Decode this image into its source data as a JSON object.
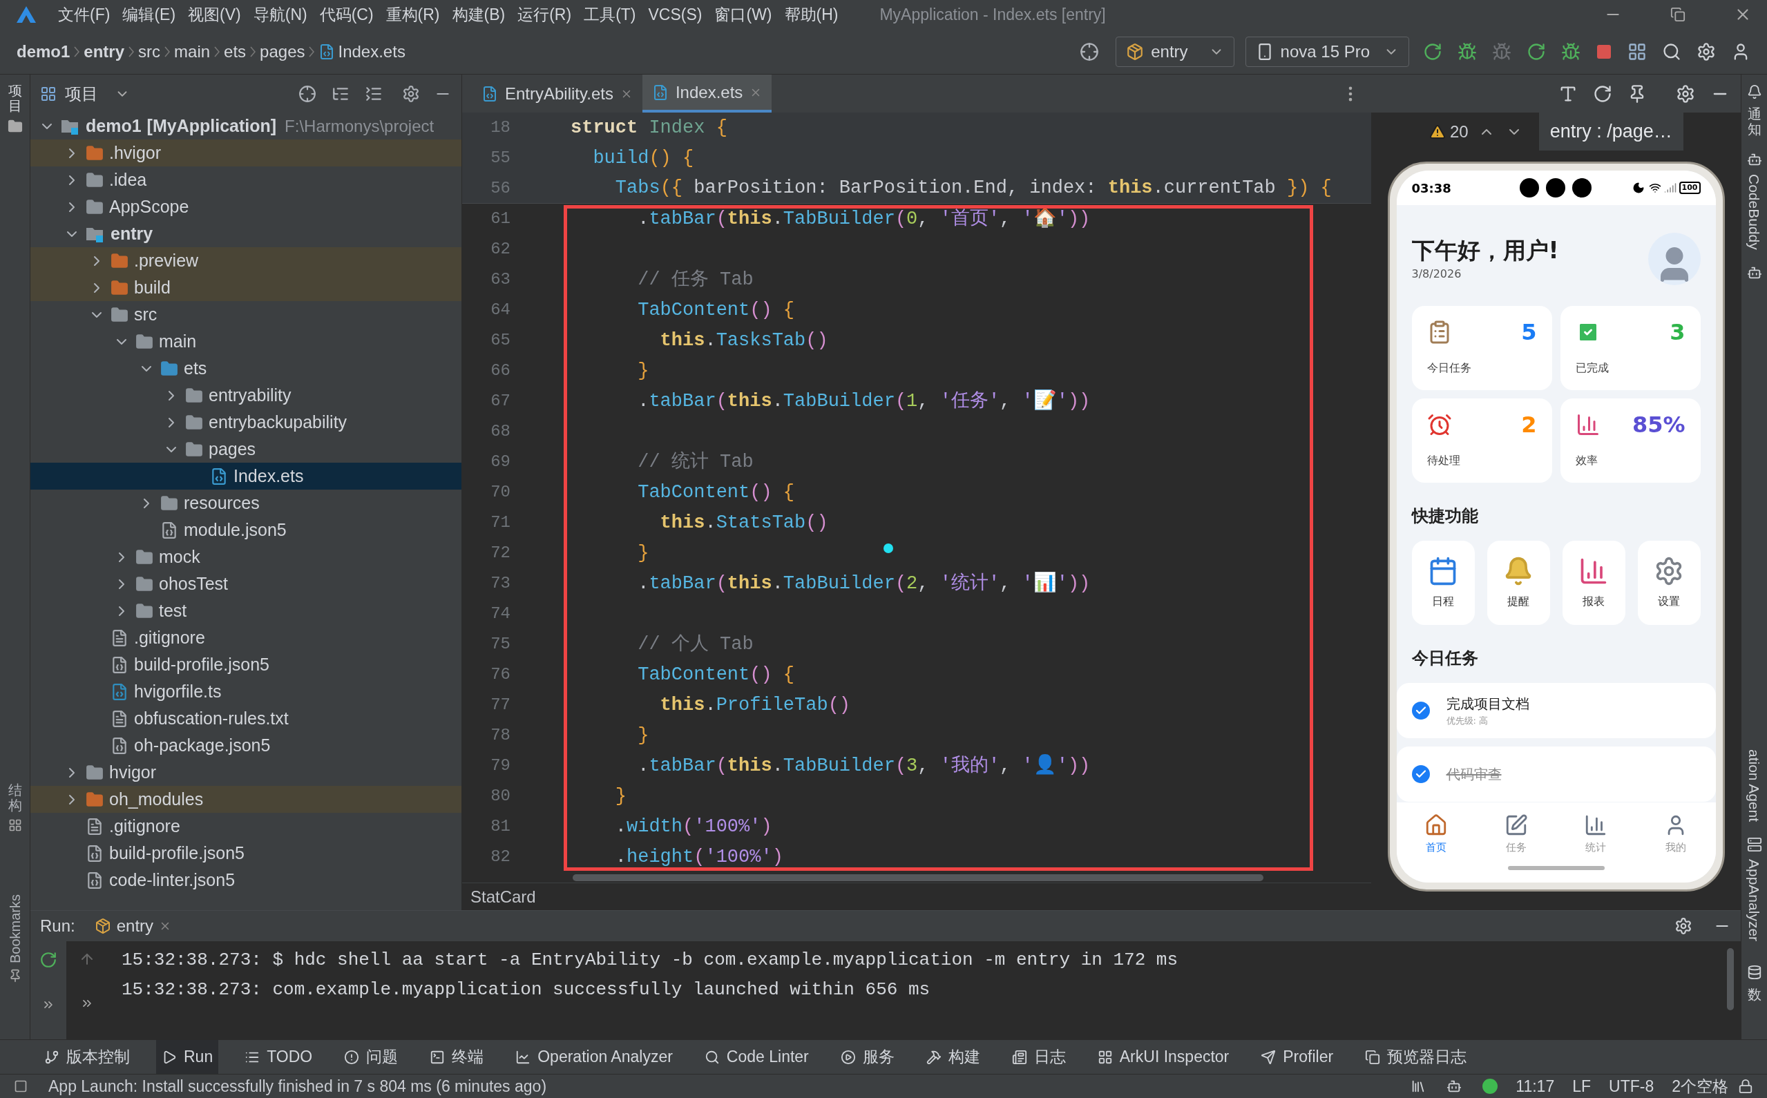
{
  "window": {
    "title": "MyApplication - Index.ets [entry]",
    "menu": [
      "文件(F)",
      "编辑(E)",
      "视图(V)",
      "导航(N)",
      "代码(C)",
      "重构(R)",
      "构建(B)",
      "运行(R)",
      "工具(T)",
      "VCS(S)",
      "窗口(W)",
      "帮助(H)"
    ]
  },
  "breadcrumb": [
    {
      "label": "demo1",
      "bold": true
    },
    {
      "label": "entry",
      "bold": true
    },
    {
      "label": "src",
      "bold": false
    },
    {
      "label": "main",
      "bold": false
    },
    {
      "label": "ets",
      "bold": false
    },
    {
      "label": "pages",
      "bold": false
    },
    {
      "label": "Index.ets",
      "bold": false
    }
  ],
  "toolbar": {
    "run_config": "entry",
    "device": "nova 15 Pro"
  },
  "left_strip": {
    "top": "项目",
    "bottom": "结构",
    "bookmarks": "Bookmarks"
  },
  "project": {
    "title": "项目",
    "tree": [
      {
        "label": "demo1",
        "tag": "[MyApplication]",
        "path": "F:\\Harmonys\\project",
        "kind": "module",
        "expanded": true,
        "selected": false,
        "children": [
          {
            "label": ".hvigor",
            "kind": "excluded-folder",
            "expanded": false,
            "selected": false
          },
          {
            "label": ".idea",
            "kind": "folder",
            "expanded": false,
            "selected": false
          },
          {
            "label": "AppScope",
            "kind": "folder",
            "expanded": false,
            "selected": false
          },
          {
            "label": "entry",
            "kind": "module",
            "expanded": true,
            "selected": false,
            "children": [
              {
                "label": ".preview",
                "kind": "excluded-folder",
                "expanded": false,
                "selected": false
              },
              {
                "label": "build",
                "kind": "excluded-folder",
                "expanded": false,
                "selected": false
              },
              {
                "label": "src",
                "kind": "folder",
                "expanded": true,
                "selected": false,
                "children": [
                  {
                    "label": "main",
                    "kind": "folder",
                    "expanded": true,
                    "selected": false,
                    "children": [
                      {
                        "label": "ets",
                        "kind": "source-folder",
                        "expanded": true,
                        "selected": false,
                        "children": [
                          {
                            "label": "entryability",
                            "kind": "folder",
                            "expanded": false,
                            "selected": false
                          },
                          {
                            "label": "entrybackupability",
                            "kind": "folder",
                            "expanded": false,
                            "selected": false
                          },
                          {
                            "label": "pages",
                            "kind": "folder",
                            "expanded": true,
                            "selected": false,
                            "children": [
                              {
                                "label": "Index.ets",
                                "kind": "ets-file",
                                "selected": true
                              }
                            ]
                          }
                        ]
                      },
                      {
                        "label": "resources",
                        "kind": "folder",
                        "expanded": false,
                        "selected": false
                      },
                      {
                        "label": "module.json5",
                        "kind": "json-file",
                        "selected": false
                      }
                    ]
                  },
                  {
                    "label": "mock",
                    "kind": "folder",
                    "expanded": false,
                    "selected": false
                  },
                  {
                    "label": "ohosTest",
                    "kind": "folder",
                    "expanded": false,
                    "selected": false
                  },
                  {
                    "label": "test",
                    "kind": "folder",
                    "expanded": false,
                    "selected": false
                  }
                ]
              },
              {
                "label": ".gitignore",
                "kind": "ignore-file",
                "selected": false
              },
              {
                "label": "build-profile.json5",
                "kind": "json-file",
                "selected": false
              },
              {
                "label": "hvigorfile.ts",
                "kind": "ts-file",
                "selected": false
              },
              {
                "label": "obfuscation-rules.txt",
                "kind": "text-file",
                "selected": false
              },
              {
                "label": "oh-package.json5",
                "kind": "json-file",
                "selected": false
              }
            ]
          },
          {
            "label": "hvigor",
            "kind": "folder",
            "expanded": false,
            "selected": false
          },
          {
            "label": "oh_modules",
            "kind": "excluded-folder",
            "expanded": false,
            "selected": false
          },
          {
            "label": ".gitignore",
            "kind": "ignore-file",
            "selected": false
          },
          {
            "label": "build-profile.json5",
            "kind": "json-file",
            "selected": false
          },
          {
            "label": "code-linter.json5",
            "kind": "json-file",
            "selected": false
          }
        ]
      }
    ]
  },
  "editor_tabs": [
    {
      "label": "EntryAbility.ets",
      "selected": false
    },
    {
      "label": "Index.ets",
      "selected": true
    }
  ],
  "editor": {
    "warnings": "20",
    "breadcrumb": "StatCard",
    "lines": [
      {
        "number": "18",
        "sticky": true,
        "tokens": [
          {
            "kind": "kw",
            "text": "struct "
          },
          {
            "kind": "type",
            "text": "Index "
          },
          {
            "kind": "brace",
            "text": "{"
          }
        ]
      },
      {
        "number": "55",
        "sticky": true,
        "tokens": [
          {
            "kind": "fn",
            "text": "  build"
          },
          {
            "kind": "brace",
            "text": "() {"
          }
        ]
      },
      {
        "number": "56",
        "sticky": true,
        "tokens": [
          {
            "kind": "fn",
            "text": "    Tabs"
          },
          {
            "kind": "brace",
            "text": "({"
          },
          {
            "kind": "plain",
            "text": " barPosition: BarPosition.End, index: "
          },
          {
            "kind": "this",
            "text": "this"
          },
          {
            "kind": "plain",
            "text": ".currentTab "
          },
          {
            "kind": "brace",
            "text": "}) {"
          }
        ]
      },
      {
        "number": "61",
        "sticky": false,
        "tokens": [
          {
            "kind": "plain",
            "text": "      ."
          },
          {
            "kind": "fn",
            "text": "tabBar"
          },
          {
            "kind": "paren",
            "text": "("
          },
          {
            "kind": "this",
            "text": "this"
          },
          {
            "kind": "plain",
            "text": "."
          },
          {
            "kind": "fn",
            "text": "TabBuilder"
          },
          {
            "kind": "paren",
            "text": "("
          },
          {
            "kind": "number",
            "text": "0"
          },
          {
            "kind": "plain",
            "text": ", "
          },
          {
            "kind": "string",
            "text": "'首页'"
          },
          {
            "kind": "plain",
            "text": ", "
          },
          {
            "kind": "string",
            "text": "'🏠'"
          },
          {
            "kind": "paren",
            "text": "))"
          }
        ]
      },
      {
        "number": "62",
        "sticky": false
      },
      {
        "number": "63",
        "sticky": false,
        "tokens": [
          {
            "kind": "comment",
            "text": "      // 任务 Tab"
          }
        ]
      },
      {
        "number": "64",
        "sticky": false,
        "tokens": [
          {
            "kind": "fn",
            "text": "      TabContent"
          },
          {
            "kind": "paren",
            "text": "()"
          },
          {
            "kind": "brace",
            "text": " {"
          }
        ]
      },
      {
        "number": "65",
        "sticky": false,
        "tokens": [
          {
            "kind": "this",
            "text": "        this"
          },
          {
            "kind": "plain",
            "text": "."
          },
          {
            "kind": "fn",
            "text": "TasksTab"
          },
          {
            "kind": "paren",
            "text": "()"
          }
        ]
      },
      {
        "number": "66",
        "sticky": false,
        "tokens": [
          {
            "kind": "brace",
            "text": "      }"
          }
        ]
      },
      {
        "number": "67",
        "sticky": false,
        "tokens": [
          {
            "kind": "plain",
            "text": "      ."
          },
          {
            "kind": "fn",
            "text": "tabBar"
          },
          {
            "kind": "paren",
            "text": "("
          },
          {
            "kind": "this",
            "text": "this"
          },
          {
            "kind": "plain",
            "text": "."
          },
          {
            "kind": "fn",
            "text": "TabBuilder"
          },
          {
            "kind": "paren",
            "text": "("
          },
          {
            "kind": "number",
            "text": "1"
          },
          {
            "kind": "plain",
            "text": ", "
          },
          {
            "kind": "string",
            "text": "'任务'"
          },
          {
            "kind": "plain",
            "text": ", "
          },
          {
            "kind": "string",
            "text": "'📝'"
          },
          {
            "kind": "paren",
            "text": "))"
          }
        ]
      },
      {
        "number": "68",
        "sticky": false
      },
      {
        "number": "69",
        "sticky": false,
        "tokens": [
          {
            "kind": "comment",
            "text": "      // 统计 Tab"
          }
        ]
      },
      {
        "number": "70",
        "sticky": false,
        "tokens": [
          {
            "kind": "fn",
            "text": "      TabContent"
          },
          {
            "kind": "paren",
            "text": "()"
          },
          {
            "kind": "brace",
            "text": " {"
          }
        ]
      },
      {
        "number": "71",
        "sticky": false,
        "tokens": [
          {
            "kind": "this",
            "text": "        this"
          },
          {
            "kind": "plain",
            "text": "."
          },
          {
            "kind": "fn",
            "text": "StatsTab"
          },
          {
            "kind": "paren",
            "text": "()"
          }
        ]
      },
      {
        "number": "72",
        "sticky": false,
        "tokens": [
          {
            "kind": "brace",
            "text": "      }"
          }
        ]
      },
      {
        "number": "73",
        "sticky": false,
        "tokens": [
          {
            "kind": "plain",
            "text": "      ."
          },
          {
            "kind": "fn",
            "text": "tabBar"
          },
          {
            "kind": "paren",
            "text": "("
          },
          {
            "kind": "this",
            "text": "this"
          },
          {
            "kind": "plain",
            "text": "."
          },
          {
            "kind": "fn",
            "text": "TabBuilder"
          },
          {
            "kind": "paren",
            "text": "("
          },
          {
            "kind": "number",
            "text": "2"
          },
          {
            "kind": "plain",
            "text": ", "
          },
          {
            "kind": "string",
            "text": "'统计'"
          },
          {
            "kind": "plain",
            "text": ", "
          },
          {
            "kind": "string",
            "text": "'📊'"
          },
          {
            "kind": "paren",
            "text": "))"
          }
        ]
      },
      {
        "number": "74",
        "sticky": false
      },
      {
        "number": "75",
        "sticky": false,
        "tokens": [
          {
            "kind": "comment",
            "text": "      // 个人 Tab"
          }
        ]
      },
      {
        "number": "76",
        "sticky": false,
        "tokens": [
          {
            "kind": "fn",
            "text": "      TabContent"
          },
          {
            "kind": "paren",
            "text": "()"
          },
          {
            "kind": "brace",
            "text": " {"
          }
        ]
      },
      {
        "number": "77",
        "sticky": false,
        "tokens": [
          {
            "kind": "this",
            "text": "        this"
          },
          {
            "kind": "plain",
            "text": "."
          },
          {
            "kind": "fn",
            "text": "ProfileTab"
          },
          {
            "kind": "paren",
            "text": "()"
          }
        ]
      },
      {
        "number": "78",
        "sticky": false,
        "tokens": [
          {
            "kind": "brace",
            "text": "      }"
          }
        ]
      },
      {
        "number": "79",
        "sticky": false,
        "tokens": [
          {
            "kind": "plain",
            "text": "      ."
          },
          {
            "kind": "fn",
            "text": "tabBar"
          },
          {
            "kind": "paren",
            "text": "("
          },
          {
            "kind": "this",
            "text": "this"
          },
          {
            "kind": "plain",
            "text": "."
          },
          {
            "kind": "fn",
            "text": "TabBuilder"
          },
          {
            "kind": "paren",
            "text": "("
          },
          {
            "kind": "number",
            "text": "3"
          },
          {
            "kind": "plain",
            "text": ", "
          },
          {
            "kind": "string",
            "text": "'我的'"
          },
          {
            "kind": "plain",
            "text": ", "
          },
          {
            "kind": "string",
            "text": "'👤'"
          },
          {
            "kind": "paren",
            "text": "))"
          }
        ]
      },
      {
        "number": "80",
        "sticky": false,
        "tokens": [
          {
            "kind": "brace",
            "text": "    }"
          }
        ]
      },
      {
        "number": "81",
        "sticky": false,
        "tokens": [
          {
            "kind": "plain",
            "text": "    ."
          },
          {
            "kind": "fn",
            "text": "width"
          },
          {
            "kind": "paren",
            "text": "("
          },
          {
            "kind": "string",
            "text": "'100%'"
          },
          {
            "kind": "paren",
            "text": ")"
          }
        ]
      },
      {
        "number": "82",
        "sticky": false,
        "tokens": [
          {
            "kind": "plain",
            "text": "    ."
          },
          {
            "kind": "fn",
            "text": "height"
          },
          {
            "kind": "paren",
            "text": "("
          },
          {
            "kind": "string",
            "text": "'100%'"
          },
          {
            "kind": "paren",
            "text": ")"
          }
        ]
      }
    ]
  },
  "preview": {
    "title": "entry : /page…",
    "phone": {
      "time": "03:38",
      "battery": "100",
      "greeting": "下午好，用户!",
      "date": "3/8/2026",
      "stats": [
        {
          "value": "5",
          "label": "今日任务",
          "color": "#1a7cf5"
        },
        {
          "value": "3",
          "label": "已完成",
          "color": "#2fb44a"
        },
        {
          "value": "2",
          "label": "待处理",
          "color": "#ff8a00"
        },
        {
          "value": "85%",
          "label": "效率",
          "color": "#5a4fd3"
        }
      ],
      "quick_title": "快捷功能",
      "quick": [
        "日程",
        "提醒",
        "报表",
        "设置"
      ],
      "tasks_title": "今日任务",
      "tasks": [
        {
          "title": "完成项目文档",
          "subtitle": "优先级: 高",
          "checked": true,
          "completed": false
        },
        {
          "title": "代码审查",
          "checked": true,
          "completed": true
        }
      ],
      "nav": [
        {
          "label": "首页",
          "selected": true
        },
        {
          "label": "任务",
          "selected": false
        },
        {
          "label": "统计",
          "selected": false
        },
        {
          "label": "我的",
          "selected": false
        }
      ]
    }
  },
  "right_strip": {
    "top": "通知",
    "labels": [
      "CodeBuddy",
      "ation Agent",
      "AppAnalyzer"
    ],
    "bottom": "数"
  },
  "run": {
    "label": "Run:",
    "tab": "entry",
    "lines": [
      "15:32:38.273: $ hdc shell aa start -a EntryAbility -b com.example.myapplication -m entry in 172 ms",
      "15:32:38.273: com.example.myapplication successfully launched within 656 ms"
    ]
  },
  "tool_tabs": [
    {
      "label": "版本控制",
      "selected": false
    },
    {
      "label": "Run",
      "selected": true
    },
    {
      "label": "TODO",
      "selected": false
    },
    {
      "label": "问题",
      "selected": false
    },
    {
      "label": "终端",
      "selected": false
    },
    {
      "label": "Operation Analyzer",
      "selected": false
    },
    {
      "label": "Code Linter",
      "selected": false
    },
    {
      "label": "服务",
      "selected": false
    },
    {
      "label": "构建",
      "selected": false
    },
    {
      "label": "日志",
      "selected": false
    },
    {
      "label": "ArkUI Inspector",
      "selected": false
    },
    {
      "label": "Profiler",
      "selected": false
    },
    {
      "label": "预览器日志",
      "selected": false
    }
  ],
  "status_bar": {
    "message": "App Launch: Install successfully finished in 7 s 804 ms (6 minutes ago)",
    "time": "11:17",
    "line_ending": "LF",
    "encoding": "UTF-8",
    "indent": "2个空格"
  }
}
